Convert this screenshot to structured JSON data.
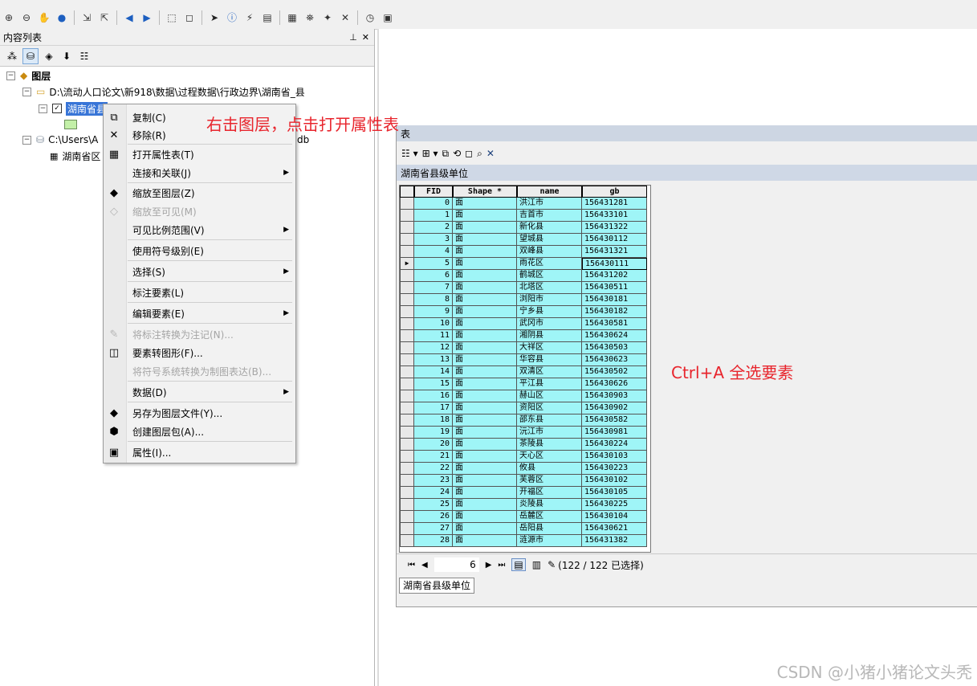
{
  "toc": {
    "title": "内容列表",
    "layers_root": "图层",
    "folder1": "D:\\流动人口论文\\新918\\数据\\过程数据\\行政边界\\湖南省_县",
    "layer1": "湖南省县",
    "folder2": "C:\\Users\\A",
    "folder2_tail": "db",
    "table_item": "湖南省区"
  },
  "context_menu": {
    "items": [
      {
        "label": "复制(C)",
        "icon": "copy-icon"
      },
      {
        "label": "移除(R)",
        "icon": "remove-icon"
      },
      {
        "label": "打开属性表(T)",
        "icon": "table-icon"
      },
      {
        "label": "连接和关联(J)",
        "icon": ""
      },
      {
        "label": "缩放至图层(Z)",
        "icon": "zoom-layer-icon"
      },
      {
        "label": "缩放至可见(M)",
        "icon": "zoom-visible-icon"
      },
      {
        "label": "可见比例范围(V)",
        "icon": ""
      },
      {
        "label": "使用符号级别(E)",
        "icon": ""
      },
      {
        "label": "选择(S)",
        "icon": ""
      },
      {
        "label": "标注要素(L)",
        "icon": ""
      },
      {
        "label": "编辑要素(E)",
        "icon": ""
      },
      {
        "label": "将标注转换为注记(N)...",
        "icon": "convert-label-icon"
      },
      {
        "label": "要素转图形(F)...",
        "icon": "feature-graphic-icon"
      },
      {
        "label": "将符号系统转换为制图表达(B)...",
        "icon": ""
      },
      {
        "label": "数据(D)",
        "icon": ""
      },
      {
        "label": "另存为图层文件(Y)...",
        "icon": "layer-file-icon"
      },
      {
        "label": "创建图层包(A)...",
        "icon": "layer-package-icon"
      },
      {
        "label": "属性(I)...",
        "icon": "properties-icon"
      }
    ]
  },
  "annotations": {
    "right_click_hint": "右击图层，点击打开属性表",
    "select_all_hint": "Ctrl+A 全选要素"
  },
  "table_window": {
    "title": "表",
    "table_name": "湖南省县级单位",
    "columns": [
      "FID",
      "Shape *",
      "name",
      "gb"
    ],
    "rows": [
      [
        "0",
        "面",
        "洪江市",
        "156431281"
      ],
      [
        "1",
        "面",
        "吉首市",
        "156433101"
      ],
      [
        "2",
        "面",
        "新化县",
        "156431322"
      ],
      [
        "3",
        "面",
        "望城县",
        "156430112"
      ],
      [
        "4",
        "面",
        "双峰县",
        "156431321"
      ],
      [
        "5",
        "面",
        "雨花区",
        "156430111"
      ],
      [
        "6",
        "面",
        "鹤城区",
        "156431202"
      ],
      [
        "7",
        "面",
        "北塔区",
        "156430511"
      ],
      [
        "8",
        "面",
        "浏阳市",
        "156430181"
      ],
      [
        "9",
        "面",
        "宁乡县",
        "156430182"
      ],
      [
        "10",
        "面",
        "武冈市",
        "156430581"
      ],
      [
        "11",
        "面",
        "湘阴县",
        "156430624"
      ],
      [
        "12",
        "面",
        "大祥区",
        "156430503"
      ],
      [
        "13",
        "面",
        "华容县",
        "156430623"
      ],
      [
        "14",
        "面",
        "双清区",
        "156430502"
      ],
      [
        "15",
        "面",
        "平江县",
        "156430626"
      ],
      [
        "16",
        "面",
        "赫山区",
        "156430903"
      ],
      [
        "17",
        "面",
        "资阳区",
        "156430902"
      ],
      [
        "18",
        "面",
        "邵东县",
        "156430582"
      ],
      [
        "19",
        "面",
        "沅江市",
        "156430981"
      ],
      [
        "20",
        "面",
        "茶陵县",
        "156430224"
      ],
      [
        "21",
        "面",
        "天心区",
        "156430103"
      ],
      [
        "22",
        "面",
        "攸县",
        "156430223"
      ],
      [
        "23",
        "面",
        "芙蓉区",
        "156430102"
      ],
      [
        "24",
        "面",
        "开福区",
        "156430105"
      ],
      [
        "25",
        "面",
        "炎陵县",
        "156430225"
      ],
      [
        "26",
        "面",
        "岳麓区",
        "156430104"
      ],
      [
        "27",
        "面",
        "岳阳县",
        "156430621"
      ],
      [
        "28",
        "面",
        "涟源市",
        "156431382"
      ]
    ],
    "current_row_marker": "▶",
    "current_page": "6",
    "selection_status": "(122 / 122 已选择)",
    "bottom_tab": "湖南省县级单位"
  },
  "watermark": "CSDN @小猪小猪论文头秃"
}
